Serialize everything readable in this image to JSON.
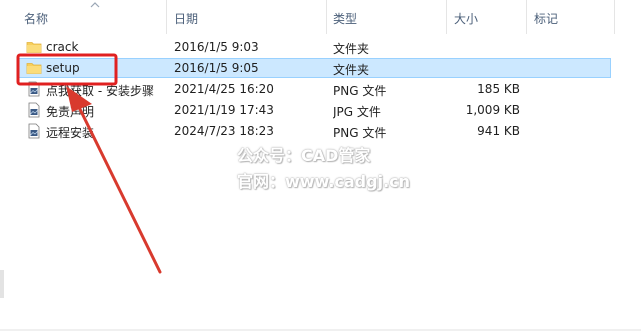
{
  "columns": {
    "name": "名称",
    "date": "日期",
    "type": "类型",
    "size": "大小",
    "tag": "标记"
  },
  "files": [
    {
      "name": "crack",
      "date": "2016/1/5 9:03",
      "type": "文件夹",
      "size": "",
      "icon": "folder-icon"
    },
    {
      "name": "setup",
      "date": "2016/1/5 9:05",
      "type": "文件夹",
      "size": "",
      "icon": "folder-icon"
    },
    {
      "name": "点我获取 - 安装步骤",
      "date": "2021/4/25 16:20",
      "type": "PNG 文件",
      "size": "185 KB",
      "icon": "image-file-icon"
    },
    {
      "name": "免责声明",
      "date": "2021/1/19 17:43",
      "type": "JPG 文件",
      "size": "1,009 KB",
      "icon": "image-file-icon"
    },
    {
      "name": "远程安装",
      "date": "2024/7/23 18:23",
      "type": "PNG 文件",
      "size": "941 KB",
      "icon": "image-file-icon"
    }
  ],
  "selected_index": 1,
  "watermark": {
    "line1": "公众号：CAD管家",
    "line2": "官网：www.cadgj.cn"
  },
  "colors": {
    "selection_fill": "#cce8ff",
    "selection_border": "#99d1ff",
    "highlight_box": "#e02020",
    "arrow": "#d83a2e",
    "folder": "#f7cf5c"
  }
}
